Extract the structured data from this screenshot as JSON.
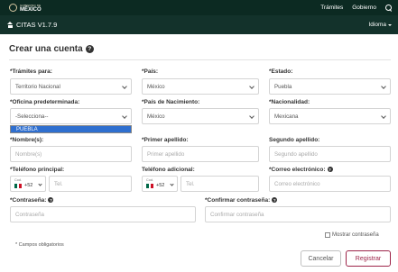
{
  "gov_header": {
    "logo_small": "GOBIERNO DE",
    "logo_big": "MÉXICO",
    "nav": [
      "Trámites",
      "Gobierno"
    ]
  },
  "app_bar": {
    "title": "CITAS V1.7.9",
    "language": "Idioma"
  },
  "form": {
    "title": "Crear una cuenta",
    "fields": {
      "tramites": {
        "label": "*Trámites para:",
        "value": "Territorio Nacional"
      },
      "pais": {
        "label": "*País:",
        "value": "México"
      },
      "estado": {
        "label": "*Estado:",
        "value": "Puebla"
      },
      "oficina": {
        "label": "*Oficina predeterminada:",
        "value": "-Selecciona--",
        "dropdown_option": "PUEBLA"
      },
      "pais_nacimiento": {
        "label": "*País de Nacimiento:",
        "value": "México"
      },
      "nacionalidad": {
        "label": "*Nacionalidad:",
        "value": "Mexicana"
      },
      "nombres": {
        "label": "*Nombre(s):",
        "placeholder": "Nombre(s)"
      },
      "primer_apellido": {
        "label": "*Primer apellido:",
        "placeholder": "Primer apellido"
      },
      "segundo_apellido": {
        "label": "Segundo apellido:",
        "placeholder": "Segundo apellido"
      },
      "telefono_principal": {
        "label": "*Teléfono principal:",
        "cod_label": "Cod.",
        "prefix": "+52",
        "placeholder": "Tel."
      },
      "telefono_adicional": {
        "label": "Teléfono adicional:",
        "cod_label": "Cod.",
        "prefix": "+52",
        "placeholder": "Tel."
      },
      "correo": {
        "label": "*Correo electrónico:",
        "placeholder": "Correo electrónico"
      },
      "contrasena": {
        "label": "*Contraseña:",
        "placeholder": "Contraseña"
      },
      "confirmar_contrasena": {
        "label": "*Confirmar contraseña:",
        "placeholder": "Confirmar contraseña"
      }
    },
    "show_password_label": "Mostrar contraseña",
    "required_note": "* Campos obligatorios",
    "cancel_label": "Cancelar",
    "register_label": "Registrar"
  },
  "colors": {
    "topbar": "#0c2a22",
    "appbar": "#13322b",
    "register_accent": "#9d2449",
    "dropdown_highlight": "#2f6fcf"
  }
}
